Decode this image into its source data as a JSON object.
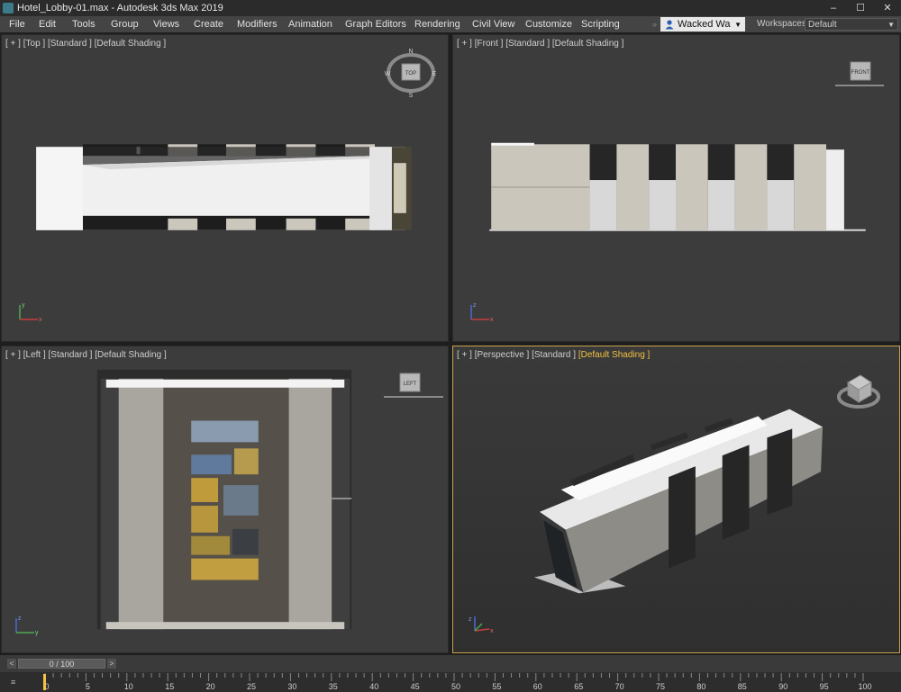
{
  "window": {
    "title": "Hotel_Lobby-01.max - Autodesk 3ds Max 2019",
    "minimize": "–",
    "maximize": "☐",
    "close": "✕"
  },
  "menu": [
    "File",
    "Edit",
    "Tools",
    "Group",
    "Views",
    "Create",
    "Modifiers",
    "Animation",
    "Graph Editors",
    "Rendering",
    "Civil View",
    "Customize",
    "Scripting"
  ],
  "user": {
    "name": "Wacked Wa",
    "icon": "user-icon"
  },
  "workspace": {
    "label": "Workspaces:",
    "value": "Default"
  },
  "viewports": {
    "top": {
      "bracket": "[ + ]",
      "view": "[Top ]",
      "shading": "[Standard ]",
      "mode": "[Default Shading ]",
      "cube": "TOP",
      "compass": [
        "N",
        "E",
        "S",
        "W"
      ]
    },
    "front": {
      "bracket": "[ + ]",
      "view": "[Front ]",
      "shading": "[Standard ]",
      "mode": "[Default Shading ]",
      "cube": "FRONT"
    },
    "left": {
      "bracket": "[ + ]",
      "view": "[Left ]",
      "shading": "[Standard ]",
      "mode": "[Default Shading ]",
      "cube": "LEFT"
    },
    "perspective": {
      "bracket": "[ + ]",
      "view": "[Perspective ]",
      "shading": "[Standard ]",
      "mode": "[Default Shading ]"
    }
  },
  "axes": {
    "x": "x",
    "y": "y",
    "z": "z"
  },
  "timeline": {
    "value": "0 / 100",
    "prev": "<",
    "next": ">"
  },
  "trackbar": {
    "ticks": [
      "0",
      "5",
      "10",
      "15",
      "20",
      "25",
      "30",
      "35",
      "40",
      "45",
      "50",
      "55",
      "60",
      "65",
      "70",
      "75",
      "80",
      "85",
      "90",
      "95",
      "100"
    ]
  },
  "colors": {
    "accent": "#f3c244",
    "viewport_bg": "#3c3c3c",
    "menu_bg": "#444444"
  }
}
